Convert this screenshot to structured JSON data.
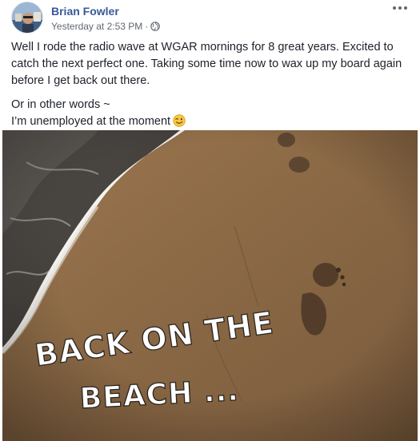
{
  "post": {
    "author": "Brian Fowler",
    "timestamp": "Yesterday at 2:53 PM",
    "separator": "·",
    "privacy_icon": "globe-icon",
    "more_icon": "more-options-icon",
    "paragraphs": [
      "Well I rode the radio wave at WGAR mornings for 8 great years. Excited to catch the next perfect one. Taking some time now to wax up my board again before I get back out there.",
      "Or in other words ~",
      "I’m unemployed at the moment"
    ],
    "emoji": "winking-face-icon"
  },
  "photo": {
    "caption_line1": "BACK ON THE",
    "caption_line2": "BEACH ...",
    "colors": {
      "sand": "#8a6845",
      "sand_light": "#a7835a",
      "water": "#3e3a37",
      "foam": "#f2f2ef"
    }
  },
  "colors": {
    "link": "#385898",
    "meta": "#606770",
    "text": "#1d2129"
  }
}
